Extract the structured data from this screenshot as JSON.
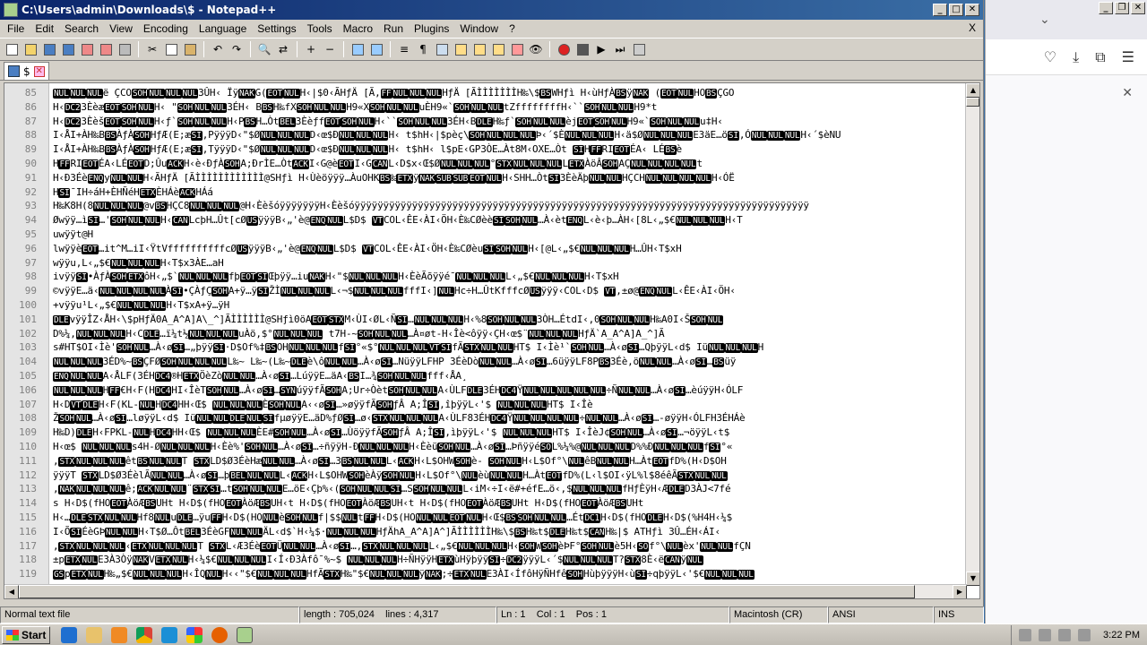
{
  "npp": {
    "title": "C:\\Users\\admin\\Downloads\\$ - Notepad++",
    "menus": [
      "File",
      "Edit",
      "Search",
      "View",
      "Encoding",
      "Language",
      "Settings",
      "Tools",
      "Macro",
      "Run",
      "Plugins",
      "Window",
      "?"
    ],
    "menu_close": "X",
    "tab_label": "$",
    "first_line": 85,
    "lines": [
      "NULNULNULë ÇCOSOHNULNULNUL3ÛH‹ ÏÿNAKG(EOTNULH‹|$0‹ÃHƒÄ [Ã,FFNULNULNULHƒÄ [ÃÌÌÌÌÌÌÌH‰\\$BSWHƒì H‹ùHƒÀBSÿNAK (EOTNULHOBSÇGO",
      "H‹DC23ÈèæEOTSOHNULH‹ \"SOHNULNUL3ÉH‹ BBSH‰fXSOHNULNULH9«XSOHNULNULuÈH9«`SOHNULNULtZffffffffH‹``SOHNULNULH9*t",
      "H‹DC23ÈèšEOTSOHNULH‹ƒ`SOHNULNULH‹PBSH…ÒtBEL3ÈèƒfEOTSOHNULH‹``SOHNULNUL3ÉH‹BDLEH‰ƒ`SOHNULNULèjEOTSOHNULH9«`SOHNULNULu‡H‹",
      "I‹ÅI+ÀH‰BBSÀƒÀSOHHƒÆ(E;æSI,PÿÿÿD‹\"$ØNULNULNULD‹œ$ÐNULNULNULH‹ t$hH‹|$pèç\\SOHNULNULNULÞ‹´$ÈNULNULNULH‹ä$ØNULNULNULE3äE…öSI,ÓNULNULNULH‹´$èNU",
      "I‹ÅI+ÀH‰BBSÀƒÀSOHHƒÆ(E;æSI,TÿÿÿD‹\"$ØNULNULNULD‹œ$ÐNULNULNULH‹ t$hH‹ l$pE‹GP3ÒE…Àt8M‹OXE…Òt SIHFFRIEOTÉA‹ LÉBSè",
      "HFFRIEOTÉA‹LÉEOTD;ÛuACKH‹è‹ÐƒÀSOHA;ÐrÌE…ÒtACKI‹G@èEOTI‹GCANL‹D$x‹Œ$ØNULNULNUL°STXNULNULNULLETXÀöÂSOHAÇNULNULNULNULt",
      "H‹Ð3ÉèENQyNULNULH‹ÃHƒÄ [ÃÌÌÌÌÌÌÌÌÌÌÌÌ@SHƒì H‹Ùèöÿÿÿ…ÀuOHKBS‰ETXÿNAKSUBSUBEOTNULH‹SHH…ÒtSI3ÈèÄþNULNULHÇCHNULNULNULNULH‹ÓË",
      "HSI¯IH÷áH+ÈHÑéHETXÈHÁèACKHÁá",
      "H‰K8H(8NULNULNUL@vBSHÇC8NULNULNUL@H‹ÈèšóÿÿÿÿÿÿÿH‹Èèšóÿÿÿÿÿÿÿÿÿÿÿÿÿÿÿÿÿÿÿÿÿÿÿÿÿÿÿÿÿÿÿÿÿÿÿÿÿÿÿÿÿÿÿÿÿÿÿÿÿÿÿÿÿÿÿÿÿÿÿÿÿÿÿÿÿÿÿÿÿÿÿÿÿÿÿÿÿÿÿ",
      "Øwÿÿ…ìSI…'SOHNULNULH‹CANLcþH…Ût[cØUSÿÿÿB‹„'è@ENQNULL$D$ VTCOL‹ÊE‹ÀI‹ÖH‹È‰CØèèSISOHNUL…À‹ètENQL‹è‹þ…ÀH‹[8L‹„$€NULNULNULH‹T",
      "uwÿÿt@H",
      "lwÿÿèEOT…it^M…iI‹ŸtVffffffffffcØUSÿÿÿB‹„'è@ENQNULL$D$ VTCOL‹ÊE‹ÀI‹ÖH‹È‰CØèuSISOHNULH‹[@L‹„$€NULNULNULH…ÛH‹T$xH",
      "wÿÿu,L‹„$€NULNULNULH‹T$x3ÀE…aH",
      "ivÿÿSI•ÀƒÀSOHETXôH‹„$`NULNULNULfþEOTSIŒþÿÿ…iuNAKH‹\"$NULNULNULH‹ÈèÃõÿÿé¯NULNULNULL‹„$€NULNULNULH‹T$xH",
      "©vÿÿE…ä‹NULNULNULNULÀSI•ÇÀƒÇSOHA+ÿ…ÿSIŽÌNULNULNULL‹¬$NULNULNULfffI‹]NULHc÷H…ÛtKfffcØUSÿÿÿ‹COL‹D$ VT,±ø@ENQNULL‹ÊE‹ÀI‹ÖH‹",
      "+vÿÿu¹L‹„$€NULNULNULH‹T$xA+ÿ…ÿH",
      "DLEvÿÿÎZ‹ÅH‹\\$pHƒÄ0A_A^A]A\\_^]ÃÌÌÌÌÌÌ@SHƒì0öAEOTSTXM‹ÙI‹ØL‹ÑSI…NULNULNULH‹%8SOHNULNUL3ÒH…ÉtdI‹,0SOHNULNULH‰A0I‹ŠSOHNUL",
      "D%¼,NULNULNULH‹CDLE…ï¼t½NULNULNULuÀö,$°NULNULNUL t7H-~SOHNULNUL…À¤øt-H‹Îè<ôÿÿ‹ÇH‹œ$¨NULNULNULHƒÄ`A_A^A]A_^]Ã",
      "s#HT$OI‹Ìè'SOHNUL…À‹øSI…„þÿÿSI·D$Of%‡BSOHNULNULNULfSI°«$°NULNULNULVTSIfÃSTXNULNULHT$ I‹Ìè¹`SOHNUL…À‹øSI…QþÿÿL‹d$ IüNULNULNULH",
      "NULNULNUL3ÉD%~BSÇFØSOHNULNULNULL‰~ L‰~(L‰~DLEè\\ôNULNUL…À‹øSI…NüÿÿLFHP 3ÉèDòNULNUL…À‹øSI…6üÿÿLF8PBS3Éè,öNULNUL…À‹øSI…BSüÿ",
      "ENQNULNULA‹ÅLF(3ÉHDC4®HETXÖèZòNULNUL…À‹øSI…LúÿÿE…äA‹BSI…¾SOHNULNULfff‹ÅA¸",
      "NULNULNULHFF€H‹F(HDC4HI‹ÎèTSOHNUL…À‹øSI…SYNúÿÿfÃSOHA;Ur÷ÒètSOHNULNULA‹ÙLFDLE3ÉHDC4ŸNULNULNULNULNUL÷ÑNULNUL…À‹øSI…èúÿÿH‹ÓLF",
      "H‹DVTDLEH‹F(KL-NULHDC4HH‹Œ$ NULNULNULÈSOHNULA‹‹øSI…»øÿÿfÃSOHƒÂ A;ÎSI,îþÿÿL‹'$ NULNULNULHT$ I‹Îè",
      "ŽSOHNUL…À‹øSI…løÿÿL‹d$ IüNULNULDLENULSIfµøÿÿE…äD%ƒØSI…ø‹STXNULNULNULA‹ÙLF83ÉHDC4ŸNULNULNULNUL÷NULNUL…À‹øSI…-øÿÿH‹ÓLFH3ÉHÁè",
      "H‰D)DLEH‹FPKL-NULHDC4HH‹Œ$ NULNULNULÈE#SOHNUL…À‹øSI…ÙöÿÿfÃSOHƒÂ A;ÎSI,ìþÿÿL‹'$ NULNULNULHT$ I‹ÎèJ¢SOHNUL…À‹øSI…¬öÿÿL‹t$",
      "H‹œ$ NULNULNULs4H-ØNULNULNULH‹Èè%'SOHNUL…À‹øSI…÷ñÿÿH-ÐNULNULNULH‹ÈèüSOHNUL…À‹øSI…ÞñÿÿéSOL%¼%@NULNULNULD%%ÐNULNULNULfSI°«",
      "‚STXNULNULNULêtBSNULNULT STXLD$Ø3ÉèHæNULNUL…À‹øSI…3BSNULNULL‹ACKH‹L$OHWSOHè- SOHNULH‹L$Of°\\NULêBNULNULH…ÀtEOTfD%(H‹D$OH",
      "ÿÿÿT STXLD$Ø3ÉèlÃNULNUL…À‹øSI…þBELNULNULL‹ACKH‹L$OHWSOHèÀÿSOHNULH‹L$Of°\\NULèùNULNULH…ÀtEOTfD%(L‹l$OI‹ÿL%l$8éêÃSTXNULNUL",
      "‚NAKNULNULNULê;ACKNULNUL¨STXSI…tSOHNULNULE…öE‹Çþ%‹(SOHNULNULSI…SSOHNULNULL‹iM‹÷I‹ë#+éfE…ö‹‚$NULNULNULfHƒÈÿH‹ÆDLED3ÀJ<7fé",
      "s H‹D$(fHOEOTÀöÆBSUHt H‹D$(fHOEOTÀöÆBSUH‹t H‹D$(fHOEOTÀöÆBSUH‹t H‹D$(fHOEOTÀöÆBSUHt H‹D$(fHOEOTÀöÆBSUHt",
      "H‹…DLESTXNULNULHf8NULuDLE…ÿuFFH‹D$(HONULèSOHNULf|$$NULtFFH‹D$(HONULNULEOTNULH‹Œ$BSSOHNULNUL…ÉtDC1H‹D$(fHODLEH‹D$(%H4H‹¼$",
      "I‹ÕSIÉèGÞNULNULH‹T$Ø…ÔtBEL3ÉèGFNULNULÄL‹d$`H‹¼$·NULNULNULHƒÄhA_A^A]A^]ÃÌÌÌÌÌÌH‰\\$BSH‰t$DLEH‰t$CANH‰|$ ATHƒì 3Û…ÉH‹ÁI‹",
      "‚STXNULNULNUL‹ETXNULNULNULT STXL‹Æ3ÉèEOTÜNULNUL…À‹øSI…‚STXNULNULNULL‹„$€NULNULNULH‹SOHWSOHèÞF°SOHNULè5H‹SOf°\\NULèx'NULNULfÇN",
      "±pETXNULE3À3ÒÿNAKVETXNULH‹¼$€NULNULNULI‹Í‹Ð3Àfô¯%~$ NULNULNULH÷ÑHÿÿHETXùHÿþÿÿSI÷DC2ÿÿÿL‹´$NULNULNULT?STX8È‹ëCANÿNUL",
      "GSpETXNULH‰„$€NULNULNULH‹ÎQNULH‹‹\"$€NULNULNULHfÃSTXH‰\"$€NULNULNULÿNAK;÷ETXNULE3ÀI‹ÍfôHÿÑHfêSOHHùþÿÿÿH‹ùSI÷qþÿÿL‹'$€NULNULNUL"
    ],
    "status": {
      "file_type": "Normal text file",
      "length": "length : 705,024",
      "lines": "lines : 4,317",
      "ln": "Ln : 1",
      "col": "Col : 1",
      "pos": "Pos : 1",
      "eol": "Macintosh (CR)",
      "encoding": "ANSI",
      "ins": "INS"
    }
  },
  "taskbar": {
    "start_label": "Start",
    "clock": "3:22 PM"
  }
}
